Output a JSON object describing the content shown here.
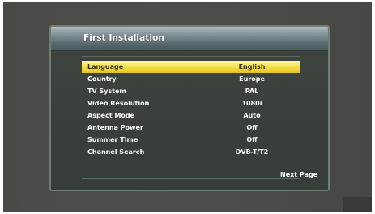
{
  "dialog": {
    "title": "First Installation"
  },
  "settings": [
    {
      "label": "Language",
      "value": "English",
      "selected": true
    },
    {
      "label": "Country",
      "value": "Europe",
      "selected": false
    },
    {
      "label": "TV System",
      "value": "PAL",
      "selected": false
    },
    {
      "label": "Video Resolution",
      "value": "1080i",
      "selected": false
    },
    {
      "label": "Aspect Mode",
      "value": "Auto",
      "selected": false
    },
    {
      "label": "Antenna Power",
      "value": "Off",
      "selected": false
    },
    {
      "label": "Summer Time",
      "value": "Off",
      "selected": false
    },
    {
      "label": "Channel Search",
      "value": "DVB-T/T2",
      "selected": false
    }
  ],
  "footer": {
    "next_page_label": "Next Page"
  },
  "colors": {
    "highlight": "#f2dc46",
    "dialog_background": "#394039",
    "header_gradient_top": "#aebcc1"
  }
}
